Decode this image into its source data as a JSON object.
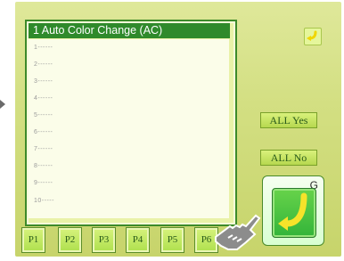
{
  "panel": {
    "title": "1 Auto Color Change (AC)",
    "items": [
      "1------",
      "2------",
      "3------",
      "4------",
      "5------",
      "6------",
      "7------",
      "8------",
      "9------",
      "10-----"
    ]
  },
  "buttons": {
    "all_yes": "ALL Yes",
    "all_no": "ALL No",
    "g_label": "G"
  },
  "tabs": [
    "P1",
    "P2",
    "P3",
    "P4",
    "P5",
    "P6"
  ],
  "colors": {
    "screen_bg": "#d3df82",
    "title_bg": "#2f8a2b",
    "panel_border": "#3d8a2a",
    "button_green": "#4dbf3b",
    "arrow_yellow": "#f0e22a"
  },
  "icons": {
    "top_right": "return-arrow-icon",
    "g_button": "curved-arrow-icon",
    "pointer": "hand-pointer-icon",
    "left_indicator": "triangle-right-icon"
  }
}
